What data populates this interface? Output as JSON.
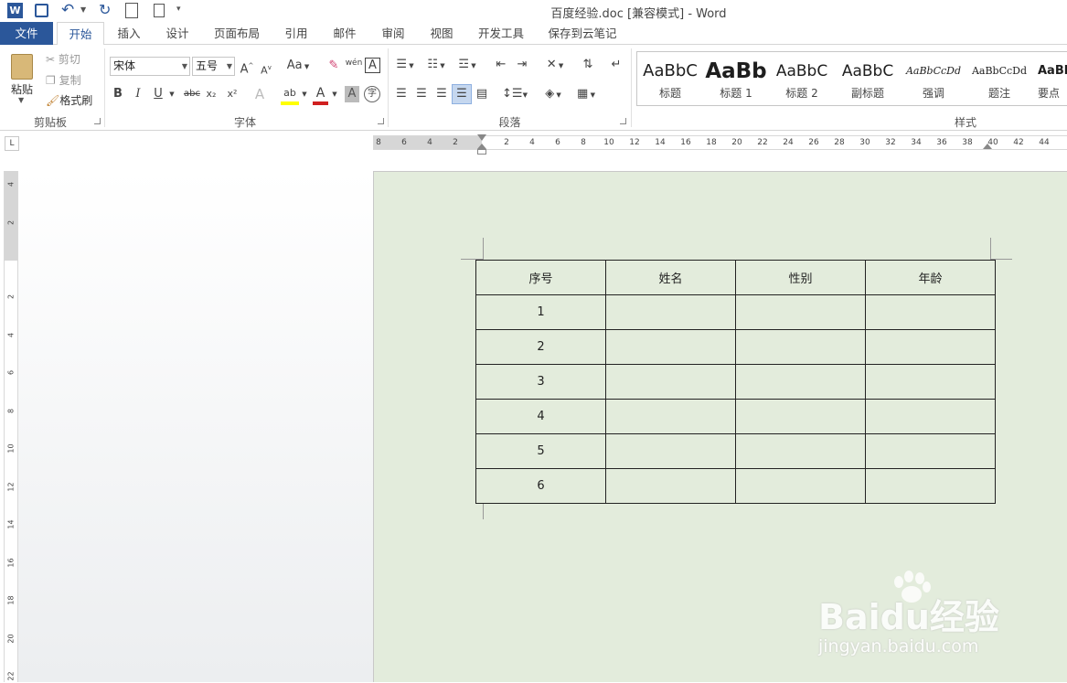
{
  "window": {
    "title": "百度经验.doc [兼容模式] - Word"
  },
  "ribbon_tabs": [
    "文件",
    "开始",
    "插入",
    "设计",
    "页面布局",
    "引用",
    "邮件",
    "审阅",
    "视图",
    "开发工具",
    "保存到云笔记"
  ],
  "clipboard": {
    "paste": "粘贴",
    "cut": "剪切",
    "copy": "复制",
    "format_painter": "格式刷",
    "group": "剪贴板"
  },
  "font": {
    "name": "宋体",
    "size": "五号",
    "group": "字体",
    "grow": "A",
    "shrink": "A",
    "case": "Aa",
    "bold": "B",
    "italic": "I",
    "underline": "U",
    "strike": "abc",
    "sub": "x₂",
    "sup": "x²",
    "text_effect": "A",
    "highlight": "ab",
    "color": "A",
    "shading": "A",
    "enclose": "字",
    "phonetic": "wén"
  },
  "paragraph": {
    "group": "段落"
  },
  "styles": {
    "group": "样式",
    "items": [
      {
        "preview": "AaBbC",
        "name": "标题"
      },
      {
        "preview": "AaBb",
        "name": "标题 1"
      },
      {
        "preview": "AaBbC",
        "name": "标题 2"
      },
      {
        "preview": "AaBbC",
        "name": "副标题"
      },
      {
        "preview": "AaBbCcDd",
        "name": "强调"
      },
      {
        "preview": "AaBbCcDd",
        "name": "题注"
      },
      {
        "preview": "AaBb",
        "name": "要点"
      }
    ]
  },
  "ruler": {
    "h_numbers": [
      "8",
      "6",
      "4",
      "2",
      "2",
      "4",
      "6",
      "8",
      "10",
      "12",
      "14",
      "16",
      "18",
      "20",
      "22",
      "24",
      "26",
      "28",
      "30",
      "32",
      "34",
      "36",
      "38",
      "40",
      "42",
      "44"
    ],
    "v_numbers": [
      "4",
      "2",
      "2",
      "4",
      "6",
      "8",
      "10",
      "12",
      "14",
      "16",
      "18",
      "20",
      "22"
    ]
  },
  "table": {
    "headers": [
      "序号",
      "姓名",
      "性别",
      "年龄"
    ],
    "rows": [
      [
        "1",
        "",
        "",
        ""
      ],
      [
        "2",
        "",
        "",
        ""
      ],
      [
        "3",
        "",
        "",
        ""
      ],
      [
        "4",
        "",
        "",
        ""
      ],
      [
        "5",
        "",
        "",
        ""
      ],
      [
        "6",
        "",
        "",
        ""
      ]
    ]
  },
  "watermark": {
    "brand": "Baidu经验",
    "url": "jingyan.baidu.com"
  },
  "colors": {
    "accent": "#2b579a",
    "page_bg": "#e3ecdc"
  }
}
